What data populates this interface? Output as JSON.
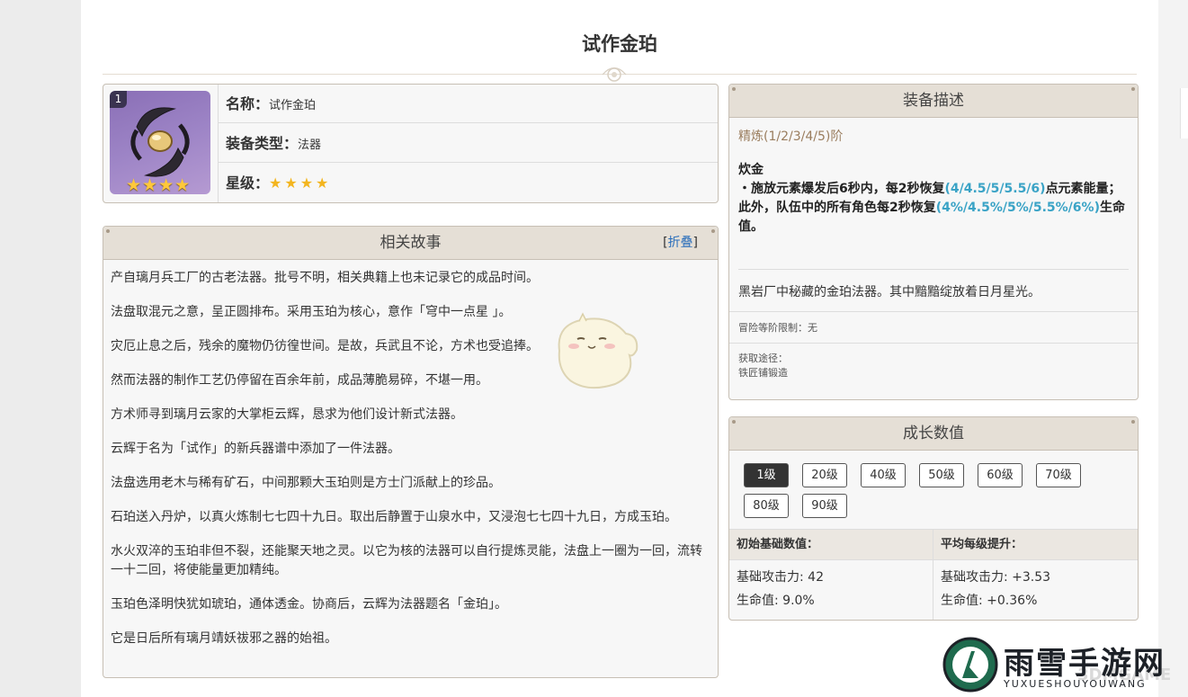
{
  "page": {
    "title": "试作金珀"
  },
  "item": {
    "rarity_badge": "1",
    "name_label": "名称：",
    "name": "试作金珀",
    "type_label": "装备类型：",
    "type": "法器",
    "star_label": "星级：",
    "stars": "★★★★",
    "icon_stars": "★★★★",
    "star_count": 4
  },
  "story": {
    "header": "相关故事",
    "fold_open": "[",
    "fold_label": "折叠",
    "fold_close": "]",
    "paragraphs": [
      "产自璃月兵工厂的古老法器。批号不明，相关典籍上也未记录它的成品时间。",
      "法盘取混元之意，呈正圆排布。采用玉珀为核心，意作「穹中一点星 」。",
      "灾厄止息之后，残余的魔物仍彷徨世间。是故，兵武且不论，方术也受追捧。",
      "然而法器的制作工艺仍停留在百余年前，成品薄脆易碎，不堪一用。",
      "方术师寻到璃月云家的大掌柜云辉，恳求为他们设计新式法器。",
      "云辉于名为「试作」的新兵器谱中添加了一件法器。",
      "法盘选用老木与稀有矿石，中间那颗大玉珀则是方士门派献上的珍品。",
      "石珀送入丹炉，以真火炼制七七四十九日。取出后静置于山泉水中，又浸泡七七四十九日，方成玉珀。",
      "水火双淬的玉珀非但不裂，还能聚天地之灵。以它为核的法器可以自行提炼灵能，法盘上一圈为一回，流转一十二回，将使能量更加精纯。",
      "玉珀色泽明快犹如琥珀，通体透金。协商后，云辉为法器题名「金珀」。",
      "它是日后所有璃月靖妖祓邪之器的始祖。"
    ]
  },
  "equip": {
    "header": "装备描述",
    "refine": "精炼(1/2/3/4/5)阶",
    "skill_name": "炊金",
    "skill_p1": "・施放元素爆发后6秒内，每2秒恢复",
    "skill_v1": "(4/4.5/5/5.5/6)",
    "skill_p2": "点元素能量；此外，队伍中的所有角色每2秒恢复",
    "skill_v2": "(4%/4.5%/5%/5.5%/6%)",
    "skill_p3": "生命值。",
    "flavor": "黑岩厂中秘藏的金珀法器。其中黯黯绽放着日月星光。",
    "limit": "冒险等阶限制：无",
    "source_label": "获取途径：",
    "source": "铁匠铺锻造"
  },
  "growth": {
    "header": "成长数值",
    "levels": [
      "1级",
      "20级",
      "40级",
      "50级",
      "60级",
      "70级",
      "80级",
      "90级"
    ],
    "active_level": "1级",
    "base_header": "初始基础数值：",
    "avg_header": "平均每级提升：",
    "base_atk": "基础攻击力: 42",
    "base_hp": "生命值: 9.0%",
    "avg_atk": "基础攻击力: +3.53",
    "avg_hp": "生命值: +0.36%"
  },
  "watermark": {
    "cn": "雨雪手游网",
    "en": "YUXUESHOUYOUWANG",
    "site": "3DMGAME"
  },
  "colors": {
    "header_bg": "#e5dfd6",
    "border": "#c7bfb4",
    "highlight": "#3aa3c6",
    "refine": "#9a7d5e",
    "star": "#f3b51f"
  }
}
